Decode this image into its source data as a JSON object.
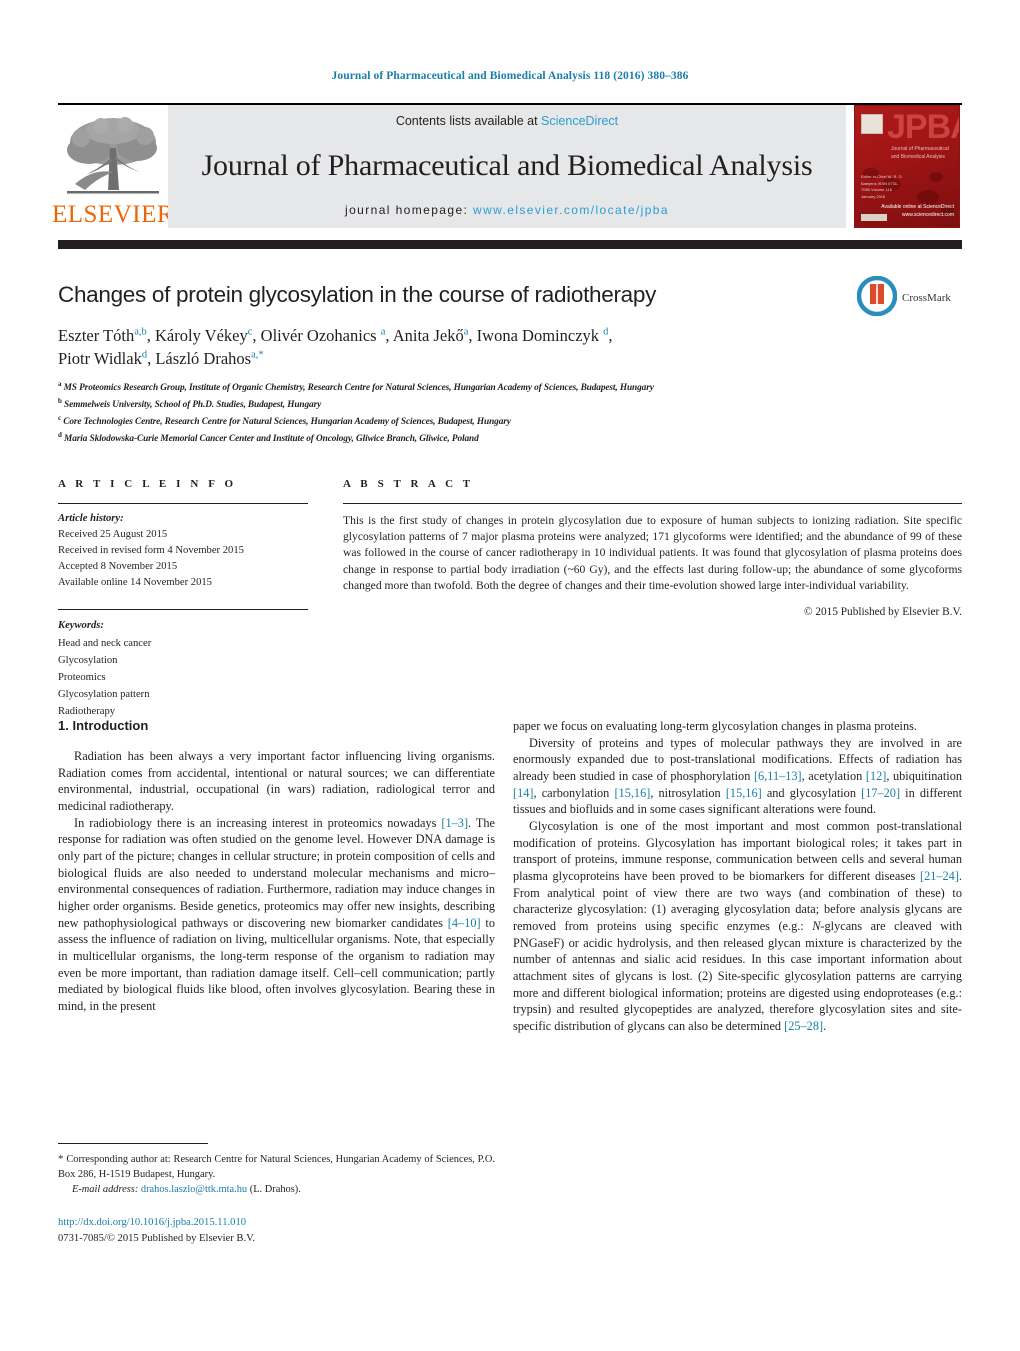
{
  "running_head": "Journal of Pharmaceutical and Biomedical Analysis 118 (2016) 380–386",
  "masthead": {
    "publisher_name": "ELSEVIER",
    "publisher_logo_icon": "elsevier-tree-icon",
    "contents_prefix": "Contents lists available at ",
    "contents_link": "ScienceDirect",
    "journal_title": "Journal of Pharmaceutical and Biomedical Analysis",
    "homepage_label": "journal homepage:",
    "homepage_url": "www.elsevier.com/locate/jpba",
    "cover": {
      "acronym": "JPBA",
      "subtitle": "Journal of Pharmaceutical and Biomedical Analysis",
      "footer_block": "Editor-in-Chief\nW. R. G. Baeyens\nISSN 0731-7085\nVolume 118\nJanuary 2016",
      "sciencedirect": "Available online at\nScienceDirect\nwww.sciencedirect.com"
    },
    "link_color": "#2b9ed4",
    "brand_color": "#eb6608"
  },
  "article": {
    "title": "Changes of protein glycosylation in the course of radiotherapy",
    "crossmark_label": "CrossMark",
    "crossmark_icon": "crossmark-icon",
    "authors": [
      {
        "name": "Eszter Tóth",
        "sup": "a,b"
      },
      {
        "name": "Károly Vékey",
        "sup": "c"
      },
      {
        "name": "Olivér Ozohanics",
        "sup": "a"
      },
      {
        "name": "Anita Jekő",
        "sup": "a"
      },
      {
        "name": "Iwona Dominczyk",
        "sup": "d"
      },
      {
        "name": "Piotr Widlak",
        "sup": "d"
      },
      {
        "name": "László Drahos",
        "sup": "a,*"
      }
    ],
    "affiliations": [
      {
        "marker": "a",
        "text": "MS Proteomics Research Group, Institute of Organic Chemistry, Research Centre for Natural Sciences, Hungarian Academy of Sciences, Budapest, Hungary"
      },
      {
        "marker": "b",
        "text": "Semmelweis University, School of Ph.D. Studies, Budapest, Hungary"
      },
      {
        "marker": "c",
        "text": "Core Technologies Centre, Research Centre for Natural Sciences, Hungarian Academy of Sciences, Budapest, Hungary"
      },
      {
        "marker": "d",
        "text": "Maria Sklodowska-Curie Memorial Cancer Center and Institute of Oncology, Gliwice Branch, Gliwice, Poland"
      }
    ]
  },
  "article_info": {
    "heading": "A R T I C L E    I N F O",
    "history_label": "Article history:",
    "history": [
      "Received 25 August 2015",
      "Received in revised form 4 November 2015",
      "Accepted 8 November 2015",
      "Available online 14 November 2015"
    ],
    "keywords_label": "Keywords:",
    "keywords": [
      "Head and neck cancer",
      "Glycosylation",
      "Proteomics",
      "Glycosylation pattern",
      "Radiotherapy"
    ]
  },
  "abstract": {
    "heading": "A B S T R A C T",
    "text": "This is the first study of changes in protein glycosylation due to exposure of human subjects to ionizing radiation. Site specific glycosylation patterns of 7 major plasma proteins were analyzed; 171 glycoforms were identified; and the abundance of 99 of these was followed in the course of cancer radiotherapy in 10 individual patients. It was found that glycosylation of plasma proteins does change in response to partial body irradiation (~60 Gy), and the effects last during follow-up; the abundance of some glycoforms changed more than twofold. Both the degree of changes and their time-evolution showed large inter-individual variability.",
    "copyright": "© 2015 Published by Elsevier B.V."
  },
  "body": {
    "section_number_title": "1.  Introduction",
    "left_paragraphs": [
      "Radiation has been always a very important factor influencing living organisms. Radiation comes from accidental, intentional or natural sources; we can differentiate environmental, industrial, occupational (in wars) radiation, radiological terror and medicinal radiotherapy.",
      "In radiobiology there is an increasing interest in proteomics nowadays [1–3]. The response for radiation was often studied on the genome level. However DNA damage is only part of the picture; changes in cellular structure; in protein composition of cells and biological fluids are also needed to understand molecular mechanisms and micro-environmental consequences of radiation. Furthermore, radiation may induce changes in higher order organisms. Beside genetics, proteomics may offer new insights, describing new pathophysiological pathways or discovering new biomarker candidates [4–10] to assess the influence of radiation on living, multicellular organisms. Note, that especially in multicellular organisms, the long-term response of the organism to radiation may even be more important, than radiation damage itself. Cell–cell communication; partly mediated by biological fluids like blood, often involves glycosylation. Bearing these in mind, in the present paper we focus on evaluating long-term glycosylation changes in plasma proteins."
    ],
    "right_paragraphs": [
      "paper we focus on evaluating long-term glycosylation changes in plasma proteins.",
      "Diversity of proteins and types of molecular pathways they are involved in are enormously expanded due to post-translational modifications. Effects of radiation has already been studied in case of phosphorylation [6,11–13], acetylation [12], ubiquitination [14], carbonylation [15,16], nitrosylation [15,16] and glycosylation [17–20] in different tissues and biofluids and in some cases significant alterations were found.",
      "Glycosylation is one of the most important and most common post-translational modification of proteins. Glycosylation has important biological roles; it takes part in transport of proteins, immune response, communication between cells and several human plasma glycoproteins have been proved to be biomarkers for different diseases [21–24]. From analytical point of view there are two ways (and combination of these) to characterize glycosylation: (1) averaging glycosylation data; before analysis glycans are removed from proteins using specific enzymes (e.g.: N-glycans are cleaved with PNGaseF) or acidic hydrolysis, and then released glycan mixture is characterized by the number of antennas and sialic acid residues. In this case important information about attachment sites of glycans is lost. (2) Site-specific glycosylation patterns are carrying more and different biological information; proteins are digested using endoproteases (e.g.: trypsin) and resulted glycopeptides are analyzed, therefore glycosylation sites and site-specific distribution of glycans can also be determined [25–28]."
    ],
    "reference_link_color": "#1a7fa8"
  },
  "footnotes": {
    "corresponding": "Corresponding author at: Research Centre for Natural Sciences, Hungarian Academy of Sciences, P.O. Box 286, H-1519 Budapest, Hungary.",
    "email_label": "E-mail address:",
    "email": "drahos.laszlo@ttk.mta.hu",
    "email_owner": "(L. Drahos).",
    "doi": "http://dx.doi.org/10.1016/j.jpba.2015.11.010",
    "issn_line": "0731-7085/© 2015 Published by Elsevier B.V."
  }
}
